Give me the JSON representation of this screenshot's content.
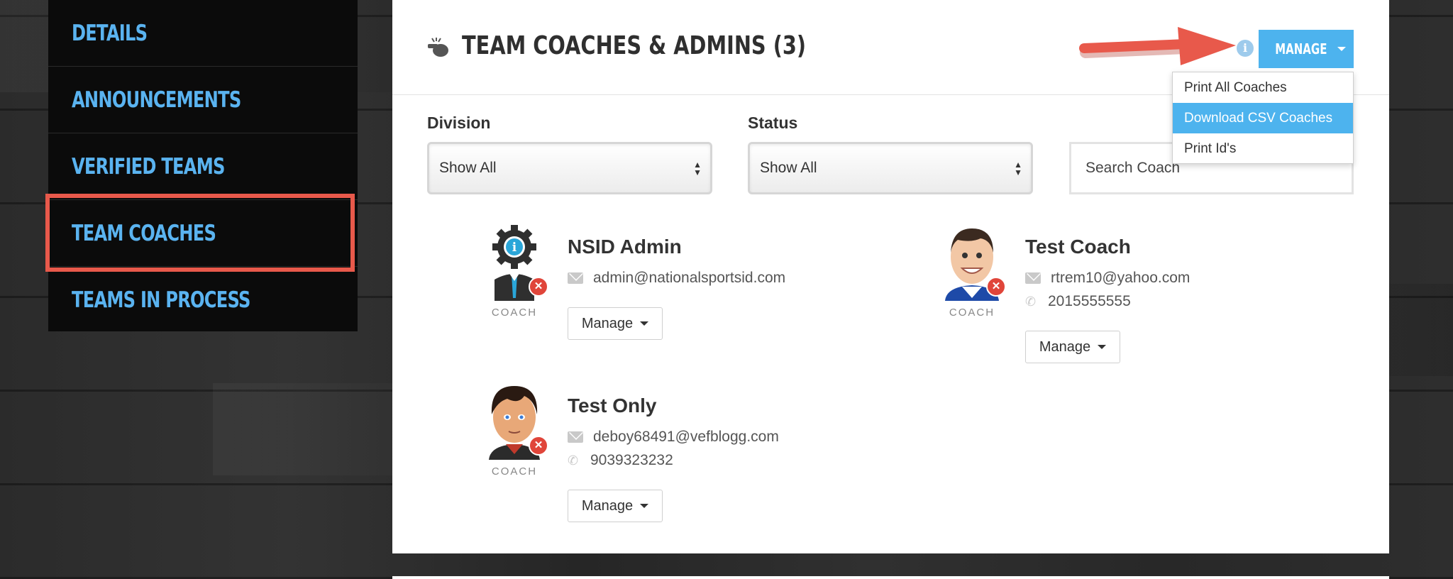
{
  "sidebar": {
    "items": [
      {
        "label": "DETAILS"
      },
      {
        "label": "ANNOUNCEMENTS"
      },
      {
        "label": "VERIFIED TEAMS"
      },
      {
        "label": "TEAM COACHES",
        "selected": true
      },
      {
        "label": "TEAMS IN PROCESS"
      }
    ]
  },
  "header": {
    "title": "TEAM COACHES & ADMINS (3)",
    "title_icon": "whistle-icon",
    "info_icon": "info-icon",
    "manage_label": "MANAGE"
  },
  "dropdown": {
    "items": [
      {
        "label": "Print All Coaches"
      },
      {
        "label": "Download CSV Coaches",
        "active": true
      },
      {
        "label": "Print Id's"
      }
    ]
  },
  "filters": {
    "division": {
      "label": "Division",
      "value": "Show All"
    },
    "status": {
      "label": "Status",
      "value": "Show All"
    },
    "search": {
      "placeholder": "Search Coach"
    }
  },
  "coaches": [
    {
      "name": "NSID Admin",
      "role": "COACH",
      "email": "admin@nationalsportsid.com",
      "phone": "",
      "avatar": "gear-info-avatar",
      "manage_label": "Manage"
    },
    {
      "name": "Test Coach",
      "role": "COACH",
      "email": "rtrem10@yahoo.com",
      "phone": "2015555555",
      "avatar": "smiling-man-avatar",
      "manage_label": "Manage"
    },
    {
      "name": "Test Only",
      "role": "COACH",
      "email": "deboy68491@vefblogg.com",
      "phone": "9039323232",
      "avatar": "young-man-avatar",
      "manage_label": "Manage"
    }
  ],
  "colors": {
    "accent": "#4db3ee",
    "sidebar_text": "#5ab3f0",
    "annotation": "#e8594b",
    "remove_badge": "#e0453a"
  }
}
